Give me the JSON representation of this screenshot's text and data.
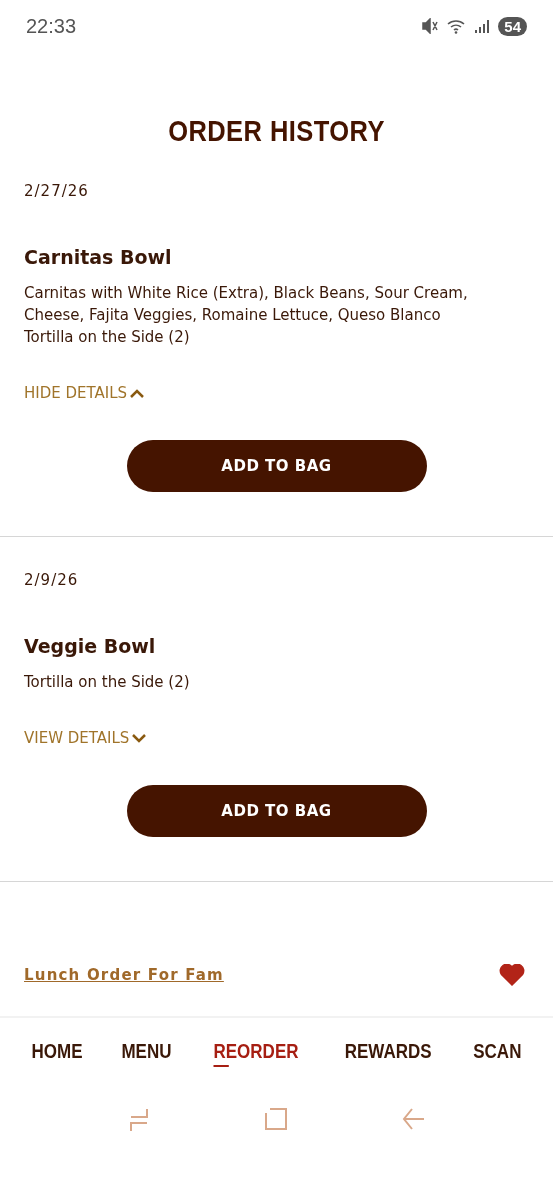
{
  "status_bar": {
    "time": "22:33",
    "battery": "54"
  },
  "title": "ORDER HISTORY",
  "orders": [
    {
      "date": "2/27/26",
      "name": "Carnitas Bowl",
      "lines": [
        "Carnitas with White Rice (Extra), Black Beans, Sour Cream, Cheese, Fajita Veggies, Romaine Lettuce, Queso Blanco",
        "Tortilla on the Side (2)"
      ],
      "toggle": "HIDE DETAILS",
      "expanded": true,
      "button": "ADD TO BAG"
    },
    {
      "date": "2/9/26",
      "name": "Veggie Bowl",
      "lines": [
        "Tortilla on the Side (2)"
      ],
      "toggle": "VIEW DETAILS",
      "expanded": false,
      "button": "ADD TO BAG"
    }
  ],
  "favorite": {
    "name": "Lunch Order For Fam",
    "favorited": true
  },
  "nav": [
    {
      "label": "HOME",
      "selected": false
    },
    {
      "label": "MENU",
      "selected": false
    },
    {
      "label": "REORDER",
      "selected": true
    },
    {
      "label": "REWARDS",
      "selected": false
    },
    {
      "label": "SCAN",
      "selected": false
    }
  ]
}
